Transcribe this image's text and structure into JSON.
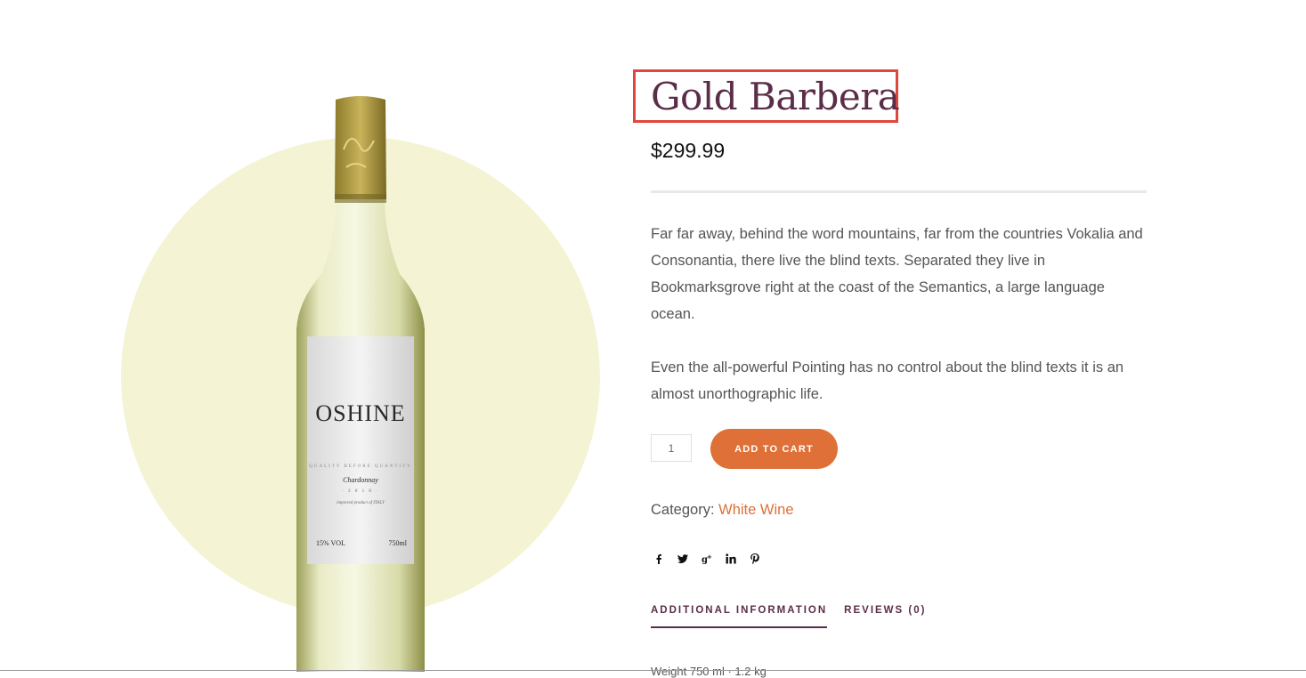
{
  "product": {
    "title": "Gold Barbera",
    "price": "$299.99",
    "description": [
      "Far far away, behind the word mountains, far from the countries Vokalia and Consonantia, there live the blind texts. Separated they live in Bookmarksgrove right at the coast of the Semantics, a large language ocean.",
      "Even the all-powerful Pointing has no control about the blind texts it is an almost unorthographic life."
    ],
    "quantity": "1",
    "add_to_cart_label": "ADD TO CART",
    "category_label": "Category:",
    "category_value": "White Wine"
  },
  "bottle_label": {
    "brand": "OSHINE",
    "tagline": "QUALITY BEFORE QUANTITY",
    "variety": "Chardonnay",
    "year": "· 2 0 1 8 ·",
    "origin": "imported product of ITALY",
    "abv": "15% VOL",
    "volume": "750ml",
    "neck_script": "White Wine"
  },
  "share_icons": [
    "facebook-icon",
    "twitter-icon",
    "google-plus-icon",
    "linkedin-icon",
    "pinterest-icon"
  ],
  "tabs": [
    {
      "label": "ADDITIONAL INFORMATION",
      "active": true
    },
    {
      "label": "REVIEWS (0)",
      "active": false
    }
  ],
  "panel_peek": "Weight            750 ml  ·  1.2 kg",
  "colors": {
    "title": "#5b2d49",
    "accent": "#df7037",
    "halo": "#f4f4d4",
    "highlight_box": "#e0463e"
  }
}
